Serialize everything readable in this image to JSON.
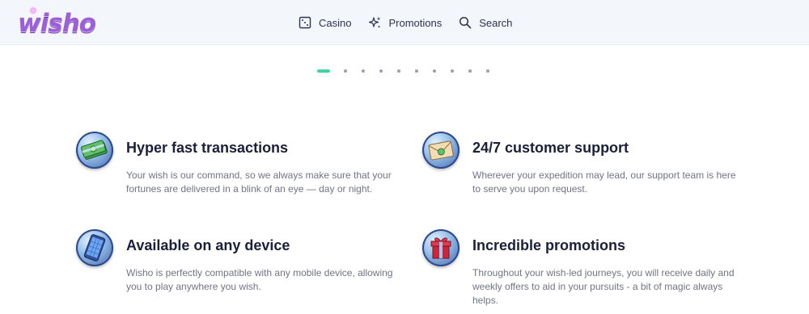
{
  "header": {
    "logo_text": "wisho",
    "nav": [
      {
        "label": "Casino",
        "icon": "dice-icon"
      },
      {
        "label": "Promotions",
        "icon": "sparkles-icon"
      },
      {
        "label": "Search",
        "icon": "search-icon"
      }
    ]
  },
  "carousel": {
    "dot_count": 10,
    "active_index": 0,
    "active_color": "#3fd4a6"
  },
  "features": [
    {
      "title": "Hyper fast transactions",
      "description": "Your wish is our command, so we always make sure that your fortunes are delivered in a blink of an eye — day or night.",
      "icon": "money-stack-icon"
    },
    {
      "title": "24/7 customer support",
      "description": "Wherever your expedition may lead, our support team is here to serve you upon request.",
      "icon": "envelope-icon"
    },
    {
      "title": "Available on any device",
      "description": "Wisho is perfectly compatible with any mobile device, allowing you to play anywhere you wish.",
      "icon": "mobile-device-icon"
    },
    {
      "title": "Incredible promotions",
      "description": "Throughout your wish-led journeys, you will receive daily and weekly offers to aid in your pursuits - a bit of magic always helps.",
      "icon": "gift-icon"
    }
  ],
  "colors": {
    "brand_purple": "#9b5fd6",
    "accent_green": "#3fd4a6",
    "heading": "#1a1f3a",
    "body_text": "#6f7585",
    "header_bg": "#f3f6fb"
  }
}
